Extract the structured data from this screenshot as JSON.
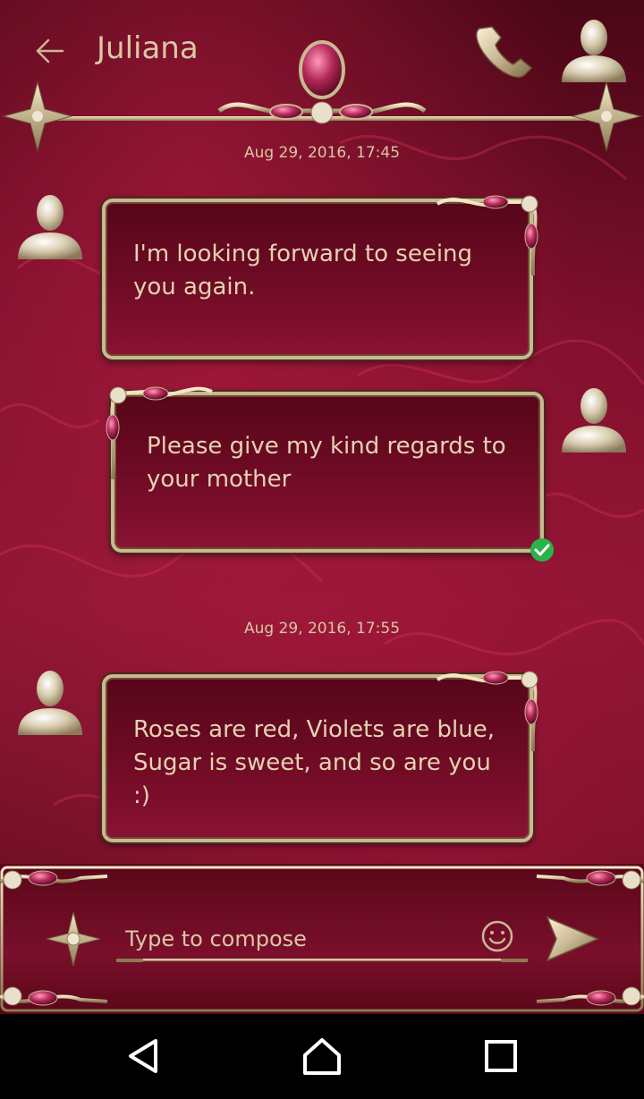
{
  "header": {
    "title": "Juliana"
  },
  "messages": [
    {
      "timestamp": "Aug 29, 2016, 17:45"
    },
    {
      "text": "I'm looking forward to seeing you again.",
      "direction": "incoming"
    },
    {
      "text": "Please give my kind regards to your mother",
      "direction": "outgoing",
      "status": "delivered"
    },
    {
      "timestamp": "Aug 29, 2016, 17:55"
    },
    {
      "text": "Roses are red, Violets are blue, Sugar is sweet, and so are you :)",
      "direction": "incoming"
    }
  ],
  "compose": {
    "placeholder": "Type to compose"
  },
  "icons": {
    "back": "arrow-left-icon",
    "call": "phone-icon",
    "contact": "contact-icon",
    "menu": "ornament-menu-icon",
    "emoji": "smiley-icon",
    "send": "send-arrow-icon",
    "nav_back": "triangle-back-icon",
    "nav_home": "home-icon",
    "nav_recents": "square-recents-icon"
  },
  "colors": {
    "gold": "#c9b892",
    "burgundy": "#7a0f2b",
    "text": "#e5d2b1",
    "check": "#2ab34a"
  }
}
